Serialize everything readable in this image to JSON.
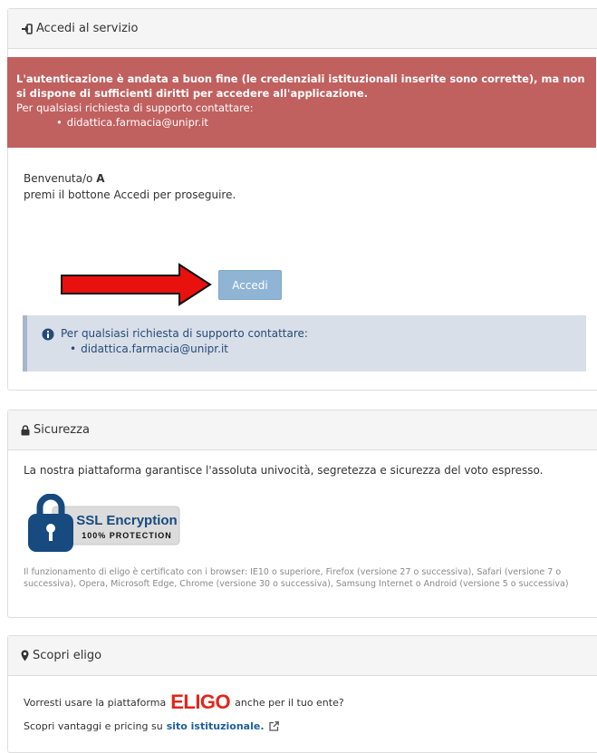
{
  "login_panel": {
    "title": "Accedi al servizio",
    "icon": "sign-in-icon",
    "error": {
      "bold_text": "L'autenticazione è andata a buon fine (le credenziali istituzionali inserite sono corrette), ma non si dispone di sufficienti diritti per accedere all'applicazione.",
      "support_text": "Per qualsiasi richiesta di supporto contattare:",
      "email": "didattica.farmacia@unipr.it",
      "color": "#c0605f"
    },
    "welcome": {
      "prefix": "Benvenuta/o",
      "name": "A",
      "instruction": "premi il bottone Accedi per proseguire."
    },
    "accedi_button": "Accedi",
    "annotation_arrow_color": "#e8110e",
    "info": {
      "text": "Per qualsiasi richiesta di supporto contattare:",
      "email": "didattica.farmacia@unipr.it",
      "icon": "info-circle-icon"
    }
  },
  "security_panel": {
    "title": "Sicurezza",
    "icon": "lock-icon",
    "text": "La nostra piattaforma garantisce l'assoluta univocità, segretezza e sicurezza del voto espresso.",
    "ssl_badge": {
      "line1": "SSL Encryption",
      "line2": "100% PROTECTION"
    },
    "browsers_text": "Il funzionamento di eligo è certificato con i browser: IE10 o superiore, Firefox (versione 27 o successiva), Safari (versione 7 o successiva), Opera, Microsoft Edge, Chrome (versione 30 o successiva), Samsung Internet o Android (versione 5 o successiva)"
  },
  "discover_panel": {
    "title": "Scopri eligo",
    "icon": "map-marker-icon",
    "line1_prefix": "Vorresti usare la piattaforma",
    "logo_text": "ELIGO",
    "line1_suffix": "anche per il tuo ente?",
    "line2_prefix": "Scopri vantaggi e pricing su",
    "link_text": "sito istituzionale.",
    "link_icon": "external-link-icon"
  }
}
